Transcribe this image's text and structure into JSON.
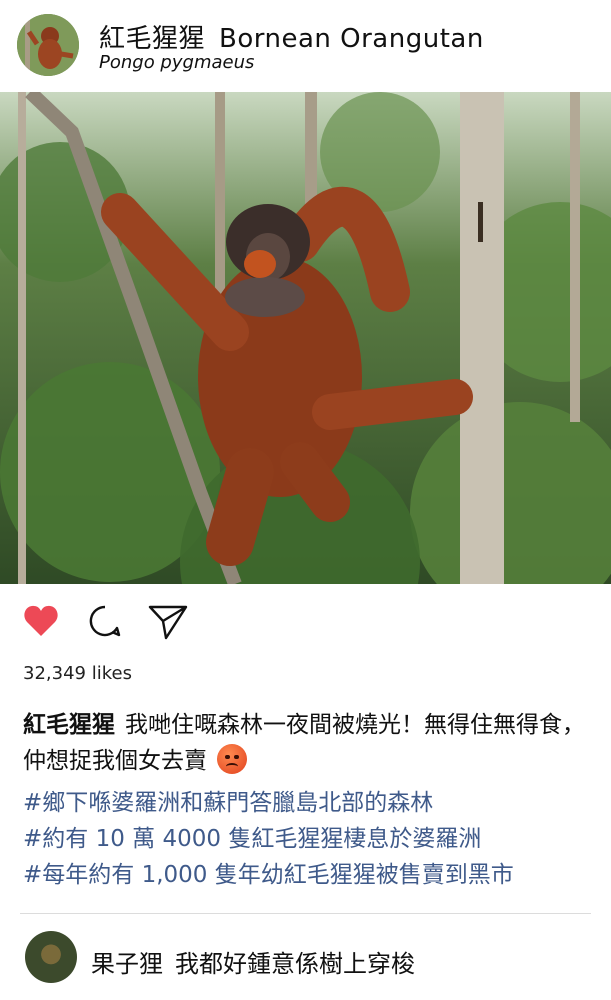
{
  "post": {
    "username_zh": "紅毛猩猩",
    "username_en": "Bornean Orangutan",
    "scientific_name": "Pongo pygmaeus",
    "likes": "32,349 likes"
  },
  "icons": [
    "heart-icon",
    "comment-icon",
    "share-icon",
    "angry-emoji-icon"
  ],
  "colors": {
    "heart": "#ed4956",
    "hashtag": "#3f5a8a",
    "divider": "#dcdcdc"
  },
  "caption": {
    "user": "紅毛猩猩",
    "text": "我哋住嘅森林一夜間被燒光！無得住無得食，仲想捉我個女去賣"
  },
  "hashtags": [
    "#鄉下喺婆羅洲和蘇門答臘島北部的森林",
    "#約有 10 萬 4000 隻紅毛猩猩棲息於婆羅洲",
    "#每年約有 1,000 隻年幼紅毛猩猩被售賣到黑市"
  ],
  "comment": {
    "user": "果子狸",
    "text": "我都好鍾意係樹上穿梭"
  }
}
